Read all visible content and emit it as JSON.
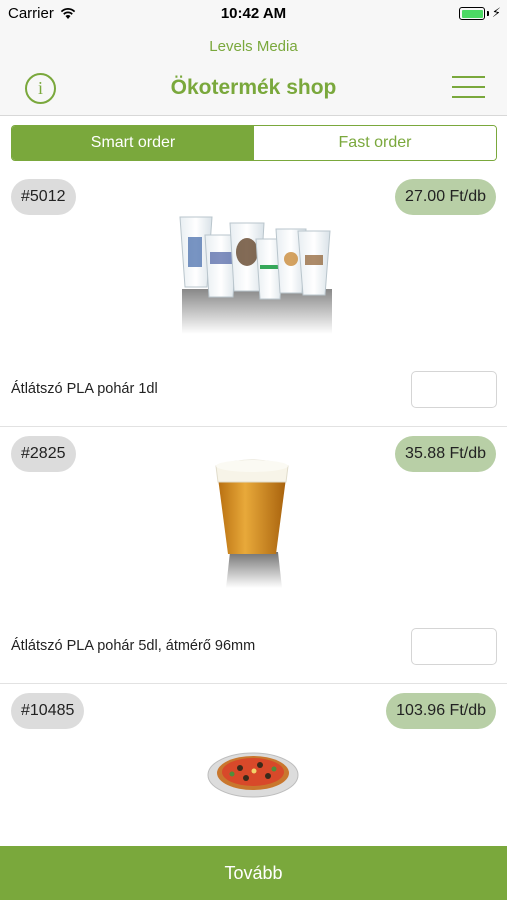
{
  "status_bar": {
    "carrier": "Carrier",
    "time": "10:42 AM"
  },
  "header": {
    "app_name": "Levels Media",
    "title": "Ökotermék shop",
    "info_icon": "info-icon",
    "menu_icon": "hamburger-menu-icon"
  },
  "segmented": {
    "smart_label": "Smart order",
    "fast_label": "Fast order",
    "selected": "Smart order"
  },
  "products": [
    {
      "sku": "#5012",
      "price": "27.00 Ft/db",
      "name": "Átlátszó PLA pohár 1dl",
      "quantity": "",
      "image": "clear-cups-image"
    },
    {
      "sku": "#2825",
      "price": "35.88 Ft/db",
      "name": "Átlátszó PLA pohár 5dl, átmérő 96mm",
      "quantity": "",
      "image": "beer-cup-image"
    },
    {
      "sku": "#10485",
      "price": "103.96 Ft/db",
      "name": "",
      "image": "pizza-plate-image"
    }
  ],
  "footer": {
    "next_label": "Tovább"
  },
  "colors": {
    "accent": "#7aa83c",
    "price_badge": "#b8cfa6",
    "sku_badge": "#dcdcdc"
  }
}
